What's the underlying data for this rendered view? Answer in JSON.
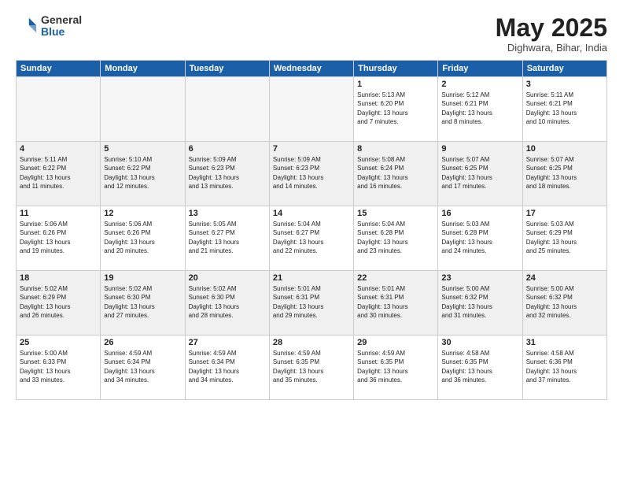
{
  "header": {
    "logo_general": "General",
    "logo_blue": "Blue",
    "month_title": "May 2025",
    "location": "Dighwara, Bihar, India"
  },
  "weekdays": [
    "Sunday",
    "Monday",
    "Tuesday",
    "Wednesday",
    "Thursday",
    "Friday",
    "Saturday"
  ],
  "weeks": [
    [
      {
        "day": "",
        "info": ""
      },
      {
        "day": "",
        "info": ""
      },
      {
        "day": "",
        "info": ""
      },
      {
        "day": "",
        "info": ""
      },
      {
        "day": "1",
        "info": "Sunrise: 5:13 AM\nSunset: 6:20 PM\nDaylight: 13 hours\nand 7 minutes."
      },
      {
        "day": "2",
        "info": "Sunrise: 5:12 AM\nSunset: 6:21 PM\nDaylight: 13 hours\nand 8 minutes."
      },
      {
        "day": "3",
        "info": "Sunrise: 5:11 AM\nSunset: 6:21 PM\nDaylight: 13 hours\nand 10 minutes."
      }
    ],
    [
      {
        "day": "4",
        "info": "Sunrise: 5:11 AM\nSunset: 6:22 PM\nDaylight: 13 hours\nand 11 minutes."
      },
      {
        "day": "5",
        "info": "Sunrise: 5:10 AM\nSunset: 6:22 PM\nDaylight: 13 hours\nand 12 minutes."
      },
      {
        "day": "6",
        "info": "Sunrise: 5:09 AM\nSunset: 6:23 PM\nDaylight: 13 hours\nand 13 minutes."
      },
      {
        "day": "7",
        "info": "Sunrise: 5:09 AM\nSunset: 6:23 PM\nDaylight: 13 hours\nand 14 minutes."
      },
      {
        "day": "8",
        "info": "Sunrise: 5:08 AM\nSunset: 6:24 PM\nDaylight: 13 hours\nand 16 minutes."
      },
      {
        "day": "9",
        "info": "Sunrise: 5:07 AM\nSunset: 6:25 PM\nDaylight: 13 hours\nand 17 minutes."
      },
      {
        "day": "10",
        "info": "Sunrise: 5:07 AM\nSunset: 6:25 PM\nDaylight: 13 hours\nand 18 minutes."
      }
    ],
    [
      {
        "day": "11",
        "info": "Sunrise: 5:06 AM\nSunset: 6:26 PM\nDaylight: 13 hours\nand 19 minutes."
      },
      {
        "day": "12",
        "info": "Sunrise: 5:06 AM\nSunset: 6:26 PM\nDaylight: 13 hours\nand 20 minutes."
      },
      {
        "day": "13",
        "info": "Sunrise: 5:05 AM\nSunset: 6:27 PM\nDaylight: 13 hours\nand 21 minutes."
      },
      {
        "day": "14",
        "info": "Sunrise: 5:04 AM\nSunset: 6:27 PM\nDaylight: 13 hours\nand 22 minutes."
      },
      {
        "day": "15",
        "info": "Sunrise: 5:04 AM\nSunset: 6:28 PM\nDaylight: 13 hours\nand 23 minutes."
      },
      {
        "day": "16",
        "info": "Sunrise: 5:03 AM\nSunset: 6:28 PM\nDaylight: 13 hours\nand 24 minutes."
      },
      {
        "day": "17",
        "info": "Sunrise: 5:03 AM\nSunset: 6:29 PM\nDaylight: 13 hours\nand 25 minutes."
      }
    ],
    [
      {
        "day": "18",
        "info": "Sunrise: 5:02 AM\nSunset: 6:29 PM\nDaylight: 13 hours\nand 26 minutes."
      },
      {
        "day": "19",
        "info": "Sunrise: 5:02 AM\nSunset: 6:30 PM\nDaylight: 13 hours\nand 27 minutes."
      },
      {
        "day": "20",
        "info": "Sunrise: 5:02 AM\nSunset: 6:30 PM\nDaylight: 13 hours\nand 28 minutes."
      },
      {
        "day": "21",
        "info": "Sunrise: 5:01 AM\nSunset: 6:31 PM\nDaylight: 13 hours\nand 29 minutes."
      },
      {
        "day": "22",
        "info": "Sunrise: 5:01 AM\nSunset: 6:31 PM\nDaylight: 13 hours\nand 30 minutes."
      },
      {
        "day": "23",
        "info": "Sunrise: 5:00 AM\nSunset: 6:32 PM\nDaylight: 13 hours\nand 31 minutes."
      },
      {
        "day": "24",
        "info": "Sunrise: 5:00 AM\nSunset: 6:32 PM\nDaylight: 13 hours\nand 32 minutes."
      }
    ],
    [
      {
        "day": "25",
        "info": "Sunrise: 5:00 AM\nSunset: 6:33 PM\nDaylight: 13 hours\nand 33 minutes."
      },
      {
        "day": "26",
        "info": "Sunrise: 4:59 AM\nSunset: 6:34 PM\nDaylight: 13 hours\nand 34 minutes."
      },
      {
        "day": "27",
        "info": "Sunrise: 4:59 AM\nSunset: 6:34 PM\nDaylight: 13 hours\nand 34 minutes."
      },
      {
        "day": "28",
        "info": "Sunrise: 4:59 AM\nSunset: 6:35 PM\nDaylight: 13 hours\nand 35 minutes."
      },
      {
        "day": "29",
        "info": "Sunrise: 4:59 AM\nSunset: 6:35 PM\nDaylight: 13 hours\nand 36 minutes."
      },
      {
        "day": "30",
        "info": "Sunrise: 4:58 AM\nSunset: 6:35 PM\nDaylight: 13 hours\nand 36 minutes."
      },
      {
        "day": "31",
        "info": "Sunrise: 4:58 AM\nSunset: 6:36 PM\nDaylight: 13 hours\nand 37 minutes."
      }
    ]
  ]
}
